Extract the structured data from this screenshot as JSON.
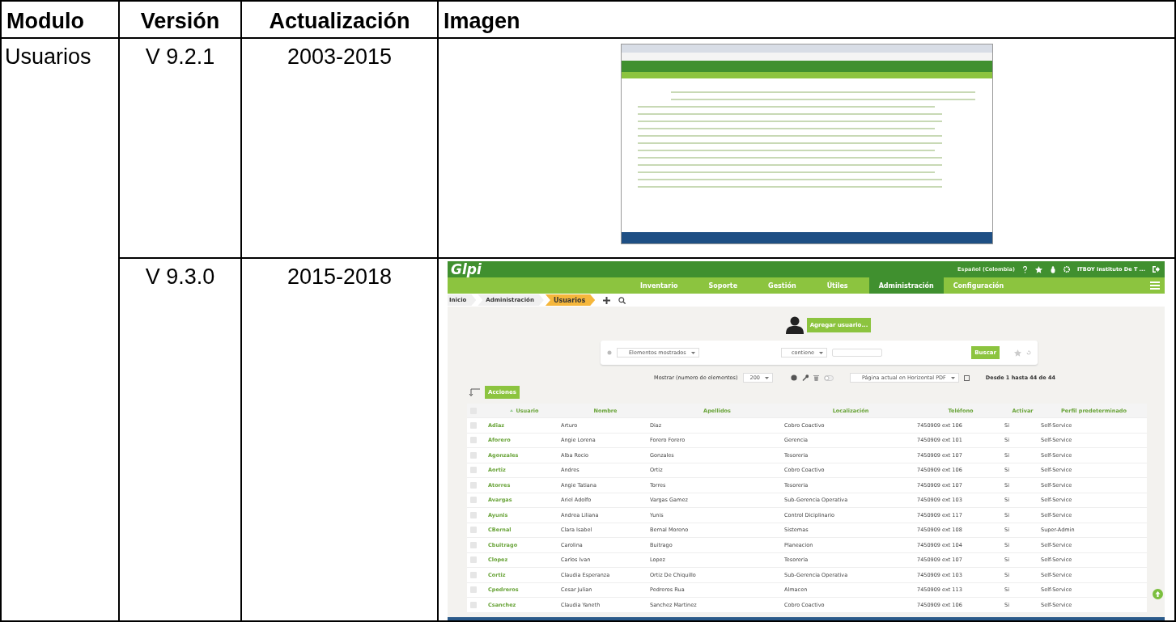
{
  "table": {
    "columns": [
      "Modulo",
      "Versión",
      "Actualización",
      "Imagen"
    ],
    "rows": [
      {
        "module": "Usuarios",
        "entries": [
          {
            "version": "V 9.2.1",
            "period": "2003-2015",
            "image": {
              "kind": "thumbnail"
            }
          },
          {
            "version": "V 9.3.0",
            "period": "2015-2018",
            "image": {
              "kind": "app",
              "logo": "Glpi",
              "language": "Español (Colombia)",
              "entity": "ITBOY Instituto De T ...",
              "nav": [
                {
                  "label": "Inventario",
                  "selected": false
                },
                {
                  "label": "Soporte",
                  "selected": false
                },
                {
                  "label": "Gestión",
                  "selected": false
                },
                {
                  "label": "Útiles",
                  "selected": false
                },
                {
                  "label": "Administración",
                  "selected": true
                },
                {
                  "label": "Configuración",
                  "selected": false
                }
              ],
              "breadcrumb": [
                {
                  "label": "Inicio",
                  "selected": false
                },
                {
                  "label": "Administración",
                  "selected": false
                },
                {
                  "label": "Usuarios",
                  "selected": true
                }
              ],
              "add_button": "Agregar usuario...",
              "search": {
                "field": "Elementos mostrados",
                "operator": "contiene",
                "button": "Buscar"
              },
              "display": {
                "label": "Mostrar (numero de elementos)",
                "count": "200",
                "export": "Página actual en Horizontal PDF",
                "pagination": "Desde 1 hasta 44 de 44"
              },
              "actions": "Acciones",
              "all_checked": false,
              "columns": [
                "Usuario",
                "Nombre",
                "Apellidos",
                "Localización",
                "Teléfono",
                "Activar",
                "Perfil predeterminado"
              ],
              "rows": [
                {
                  "checked": false,
                  "cells": [
                    "Adiaz",
                    "Arturo",
                    "Diaz",
                    "Cobro Coactivo",
                    "7450909 ext 106",
                    "Si",
                    "Self-Service"
                  ]
                },
                {
                  "checked": false,
                  "cells": [
                    "Aforero",
                    "Angie Lorena",
                    "Forero Forero",
                    "Gerencia",
                    "7450909 ext 101",
                    "Si",
                    "Self-Service"
                  ]
                },
                {
                  "checked": false,
                  "cells": [
                    "Agonzales",
                    "Alba Rocio",
                    "Gonzales",
                    "Tesoreria",
                    "7450909 ext 107",
                    "Si",
                    "Self-Service"
                  ]
                },
                {
                  "checked": false,
                  "cells": [
                    "Aortiz",
                    "Andres",
                    "Ortiz",
                    "Cobro Coactivo",
                    "7450909 ext 106",
                    "Si",
                    "Self-Service"
                  ]
                },
                {
                  "checked": false,
                  "cells": [
                    "Atorres",
                    "Angie Tatiana",
                    "Torres",
                    "Tesoreria",
                    "7450909 ext 107",
                    "Si",
                    "Self-Service"
                  ]
                },
                {
                  "checked": false,
                  "cells": [
                    "Avargas",
                    "Ariel Adolfo",
                    "Vargas Gamez",
                    "Sub-Gerencia Operativa",
                    "7450909 ext 103",
                    "Si",
                    "Self-Service"
                  ]
                },
                {
                  "checked": false,
                  "cells": [
                    "Ayunis",
                    "Andrea Liliana",
                    "Yunis",
                    "Control Diciplinario",
                    "7450909 ext 117",
                    "Si",
                    "Self-Service"
                  ]
                },
                {
                  "checked": false,
                  "cells": [
                    "CBernal",
                    "Clara Isabel",
                    "Bernal Moreno",
                    "Sistemas",
                    "7450909 ext 108",
                    "Si",
                    "Super-Admin"
                  ]
                },
                {
                  "checked": false,
                  "cells": [
                    "Cbuitrago",
                    "Carolina",
                    "Buitrago",
                    "Planeacion",
                    "7450909 ext 104",
                    "Si",
                    "Self-Service"
                  ]
                },
                {
                  "checked": false,
                  "cells": [
                    "Clopez",
                    "Carlos Ivan",
                    "Lopez",
                    "Tesoreria",
                    "7450909 ext 107",
                    "Si",
                    "Self-Service"
                  ]
                },
                {
                  "checked": false,
                  "cells": [
                    "Cortiz",
                    "Claudia Esperanza",
                    "Ortiz De Chiquillo",
                    "Sub-Gerencia Operativa",
                    "7450909 ext 103",
                    "Si",
                    "Self-Service"
                  ]
                },
                {
                  "checked": false,
                  "cells": [
                    "Cpedreros",
                    "Cesar Julian",
                    "Pedreros Rua",
                    "Almacen",
                    "7450909 ext 113",
                    "Si",
                    "Self-Service"
                  ]
                },
                {
                  "checked": false,
                  "cells": [
                    "Csanchez",
                    "Claudia Yaneth",
                    "Sanchez Martinez",
                    "Cobro Coactivo",
                    "7450909 ext 106",
                    "Si",
                    "Self-Service"
                  ]
                }
              ]
            }
          }
        ]
      }
    ]
  }
}
